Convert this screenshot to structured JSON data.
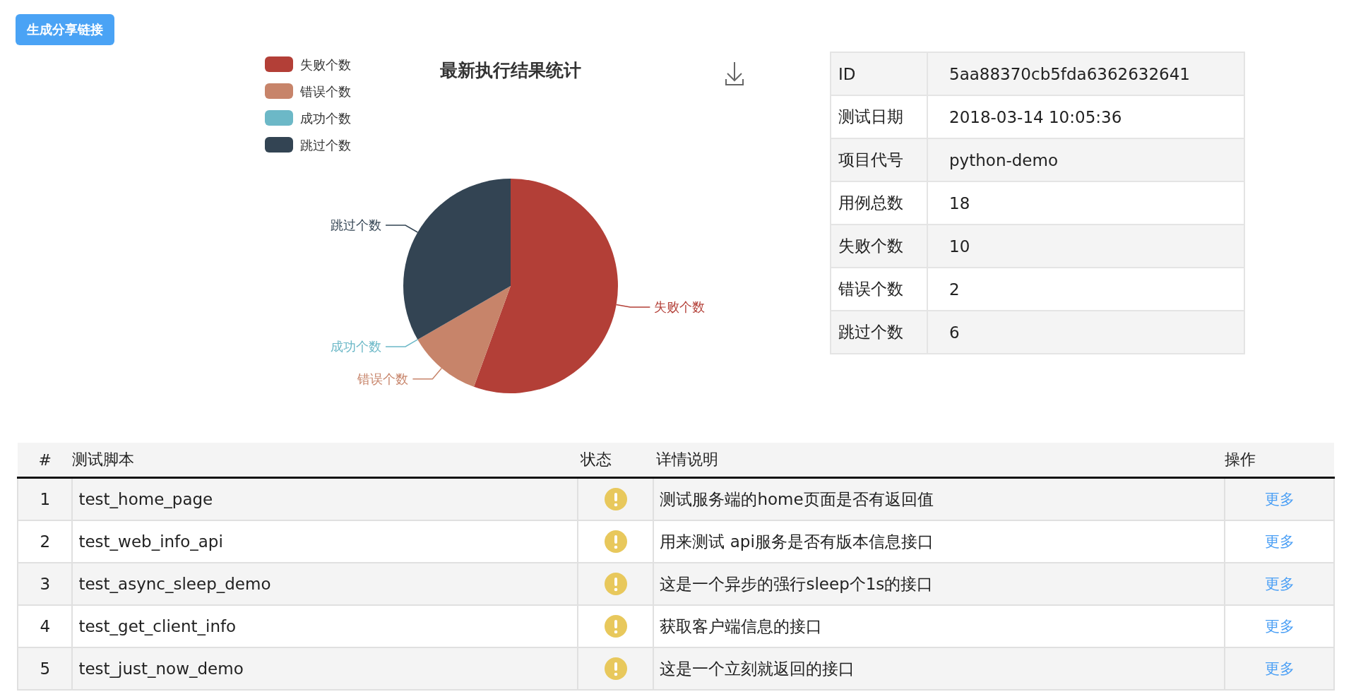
{
  "share_button": "生成分享链接",
  "chart": {
    "legend": [
      {
        "label": "失败个数",
        "color": "#b33f37"
      },
      {
        "label": "错误个数",
        "color": "#c7846a"
      },
      {
        "label": "成功个数",
        "color": "#6cb8c7"
      },
      {
        "label": "跳过个数",
        "color": "#334453"
      }
    ],
    "chart_data": {
      "type": "pie",
      "title": "最新执行结果统计",
      "categories": [
        "失败个数",
        "错误个数",
        "成功个数",
        "跳过个数"
      ],
      "values": [
        55.56,
        11.11,
        0,
        33.33
      ]
    }
  },
  "summary": [
    {
      "label": "ID",
      "value": "5aa88370cb5fda6362632641"
    },
    {
      "label": "测试日期",
      "value": "2018-03-14 10:05:36"
    },
    {
      "label": "项目代号",
      "value": "python-demo"
    },
    {
      "label": "用例总数",
      "value": "18"
    },
    {
      "label": "失败个数",
      "value": "10"
    },
    {
      "label": "错误个数",
      "value": "2"
    },
    {
      "label": "跳过个数",
      "value": "6"
    }
  ],
  "table": {
    "columns": [
      "#",
      "测试脚本",
      "状态",
      "详情说明",
      "操作"
    ],
    "rows": [
      {
        "index": "1",
        "script": "test_home_page",
        "kind": "warning",
        "detail": "测试服务端的home页面是否有返回值",
        "action": "更多"
      },
      {
        "index": "2",
        "script": "test_web_info_api",
        "kind": "warning",
        "detail": "用来测试 api服务是否有版本信息接口",
        "action": "更多"
      },
      {
        "index": "3",
        "script": "test_async_sleep_demo",
        "kind": "warning",
        "detail": "这是一个异步的强行sleep个1s的接口",
        "action": "更多"
      },
      {
        "index": "4",
        "script": "test_get_client_info",
        "kind": "warning",
        "detail": "获取客户端信息的接口",
        "action": "更多"
      },
      {
        "index": "5",
        "script": "test_just_now_demo",
        "kind": "warning",
        "detail": "这是一个立刻就返回的接口",
        "action": "更多"
      }
    ]
  }
}
